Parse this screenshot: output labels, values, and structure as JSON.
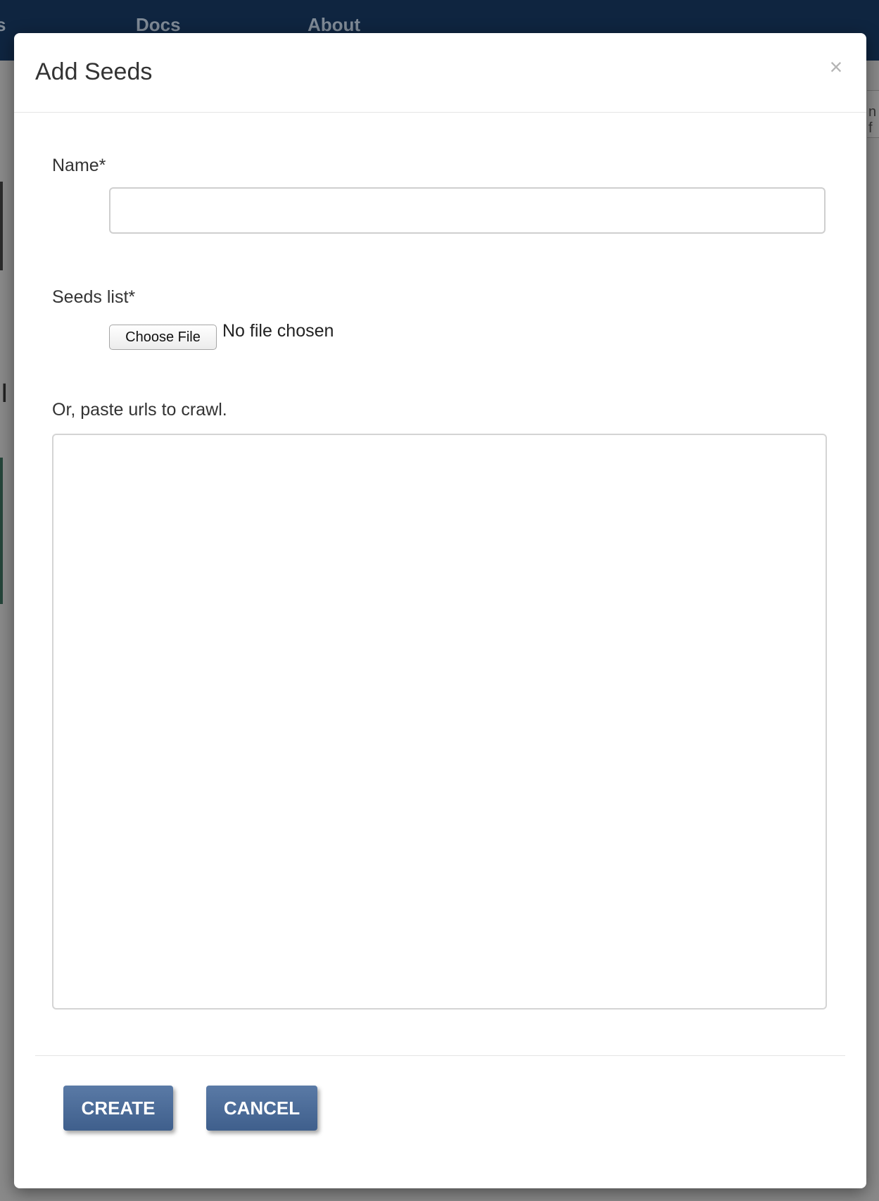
{
  "background": {
    "nav_items": [
      "s",
      "Docs",
      "About"
    ],
    "edge_text": "n f",
    "edge_glyph": "I"
  },
  "modal": {
    "title": "Add Seeds",
    "close_symbol": "×",
    "name_field": {
      "label": "Name*",
      "value": "",
      "placeholder": ""
    },
    "seeds_field": {
      "label": "Seeds list*",
      "choose_button": "Choose File",
      "status": "No file chosen"
    },
    "paste_field": {
      "label": "Or, paste urls to crawl.",
      "value": "",
      "placeholder": ""
    },
    "buttons": {
      "create": "CREATE",
      "cancel": "CANCEL"
    }
  },
  "colors": {
    "navbar": "#0f2540",
    "button": "#4a6a96",
    "overlay": "#8a8a8a"
  }
}
